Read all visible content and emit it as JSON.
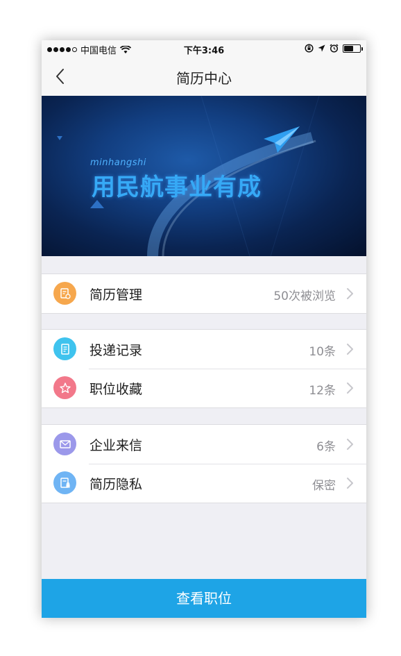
{
  "status_bar": {
    "carrier": "中国电信",
    "time": "下午3:46",
    "battery_level": 0.6
  },
  "nav": {
    "title": "简历中心",
    "back_icon": "chevron-left-icon"
  },
  "banner": {
    "subtitle": "minhangshi",
    "headline": "用民航事业有成"
  },
  "groups": [
    {
      "rows": [
        {
          "label": "简历管理",
          "value": "50次被浏览",
          "icon": "resume-settings-icon",
          "color": "#f6a74d"
        }
      ]
    },
    {
      "rows": [
        {
          "label": "投递记录",
          "value": "10条",
          "icon": "delivery-record-icon",
          "color": "#3fc3ee"
        },
        {
          "label": "职位收藏",
          "value": "12条",
          "icon": "star-icon",
          "color": "#f2788a"
        }
      ]
    },
    {
      "rows": [
        {
          "label": "企业来信",
          "value": "6条",
          "icon": "mail-icon",
          "color": "#9b98ea"
        },
        {
          "label": "简历隐私",
          "value": "保密",
          "icon": "privacy-lock-icon",
          "color": "#6fb4f4"
        }
      ]
    }
  ],
  "bottom_button": {
    "label": "查看职位",
    "color": "#1ea4e6"
  }
}
